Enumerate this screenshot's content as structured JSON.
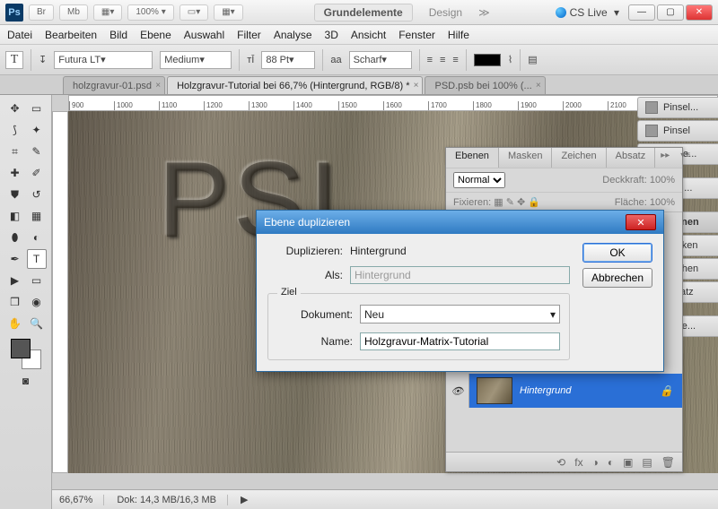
{
  "titlebar": {
    "ps": "Ps",
    "br": "Br",
    "mb": "Mb",
    "zoom": "100%",
    "grund": "Grundelemente",
    "design": "Design",
    "cslive": "CS Live"
  },
  "menus": [
    "Datei",
    "Bearbeiten",
    "Bild",
    "Ebene",
    "Auswahl",
    "Filter",
    "Analyse",
    "3D",
    "Ansicht",
    "Fenster",
    "Hilfe"
  ],
  "optbar": {
    "font": "Futura LT",
    "weight": "Medium",
    "size": "88 Pt",
    "aa_label": "aa",
    "aa_value": "Scharf"
  },
  "doctabs": [
    {
      "label": "holzgravur-01.psd",
      "active": false
    },
    {
      "label": "Holzgravur-Tutorial bei 66,7% (Hintergrund, RGB/8) *",
      "active": true
    },
    {
      "label": "PSD.psb bei 100% (...",
      "active": false
    }
  ],
  "engraved_text": "PSI",
  "ruler_marks": [
    "900",
    "1000",
    "1100",
    "1200",
    "1300",
    "1400",
    "1500",
    "1600",
    "1700",
    "1800",
    "1900",
    "2000",
    "2100"
  ],
  "status": {
    "zoom": "66,67%",
    "doc": "Dok: 14,3 MB/16,3 MB"
  },
  "right_tabs": [
    "Pinsel...",
    "Pinsel",
    "Kopie...",
    "Mini ...",
    "Ebenen",
    "Masken",
    "Zeichen",
    "Absatz",
    "Korre..."
  ],
  "right_active_index": 4,
  "layers_panel": {
    "tabs": [
      "Ebenen",
      "Masken",
      "Zeichen",
      "Absatz"
    ],
    "mode": "Normal",
    "opacity_label": "Deckkraft:",
    "opacity": "100%",
    "lock_label": "Fixieren:",
    "fill_label": "Fläche:",
    "fill": "100%",
    "layer_name": "Hintergrund"
  },
  "dialog": {
    "title": "Ebene duplizieren",
    "dup_label": "Duplizieren:",
    "dup_value": "Hintergrund",
    "as_label": "Als:",
    "as_value": "Hintergrund",
    "ziel": "Ziel",
    "doc_label": "Dokument:",
    "doc_value": "Neu",
    "name_label": "Name:",
    "name_value": "Holzgravur-Matrix-Tutorial",
    "ok": "OK",
    "cancel": "Abbrechen"
  }
}
